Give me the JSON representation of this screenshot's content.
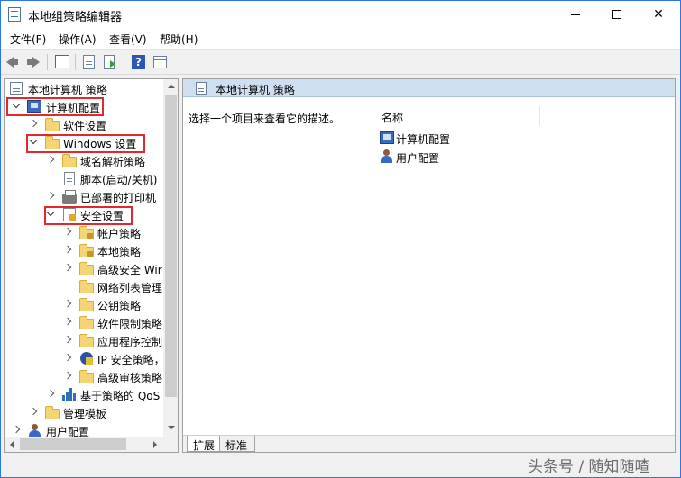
{
  "window": {
    "title": "本地组策略编辑器",
    "colors": {
      "border": "#2b78e4",
      "highlight_box": "#e0282e",
      "header_bg": "#cfdff0"
    }
  },
  "menu": {
    "file": "文件(F)",
    "action": "操作(A)",
    "view": "查看(V)",
    "help": "帮助(H)"
  },
  "toolbar": {
    "back": "back-arrow",
    "forward": "forward-arrow",
    "show_hide_tree": "console-tree-icon",
    "properties": "properties-icon",
    "export_list": "export-list-icon",
    "help": "?",
    "show_hide_action": "action-pane-icon"
  },
  "tree": {
    "root": "本地计算机 策略",
    "computer_config": "计算机配置",
    "software_settings": "软件设置",
    "windows_settings": "Windows 设置",
    "dns_policy": "域名解析策略",
    "scripts": "脚本(启动/关机)",
    "printers": "已部署的打印机",
    "security_settings": "安全设置",
    "account_policy": "帐户策略",
    "local_policy": "本地策略",
    "advanced_security": "高级安全 Wir",
    "network_list": "网络列表管理",
    "public_key": "公钥策略",
    "software_restriction": "软件限制策略",
    "app_control": "应用程序控制",
    "ipsec": "IP 安全策略，",
    "audit_config": "高级审核策略",
    "qos": "基于策略的 QoS",
    "admin_templates": "管理模板",
    "user_config": "用户配置"
  },
  "right": {
    "header_title": "本地计算机 策略",
    "description": "选择一个项目来查看它的描述。",
    "column_name": "名称",
    "items": [
      "计算机配置",
      "用户配置"
    ],
    "tab_extended": "扩展",
    "tab_standard": "标准"
  },
  "watermark": "头条号 / 随知随喳"
}
